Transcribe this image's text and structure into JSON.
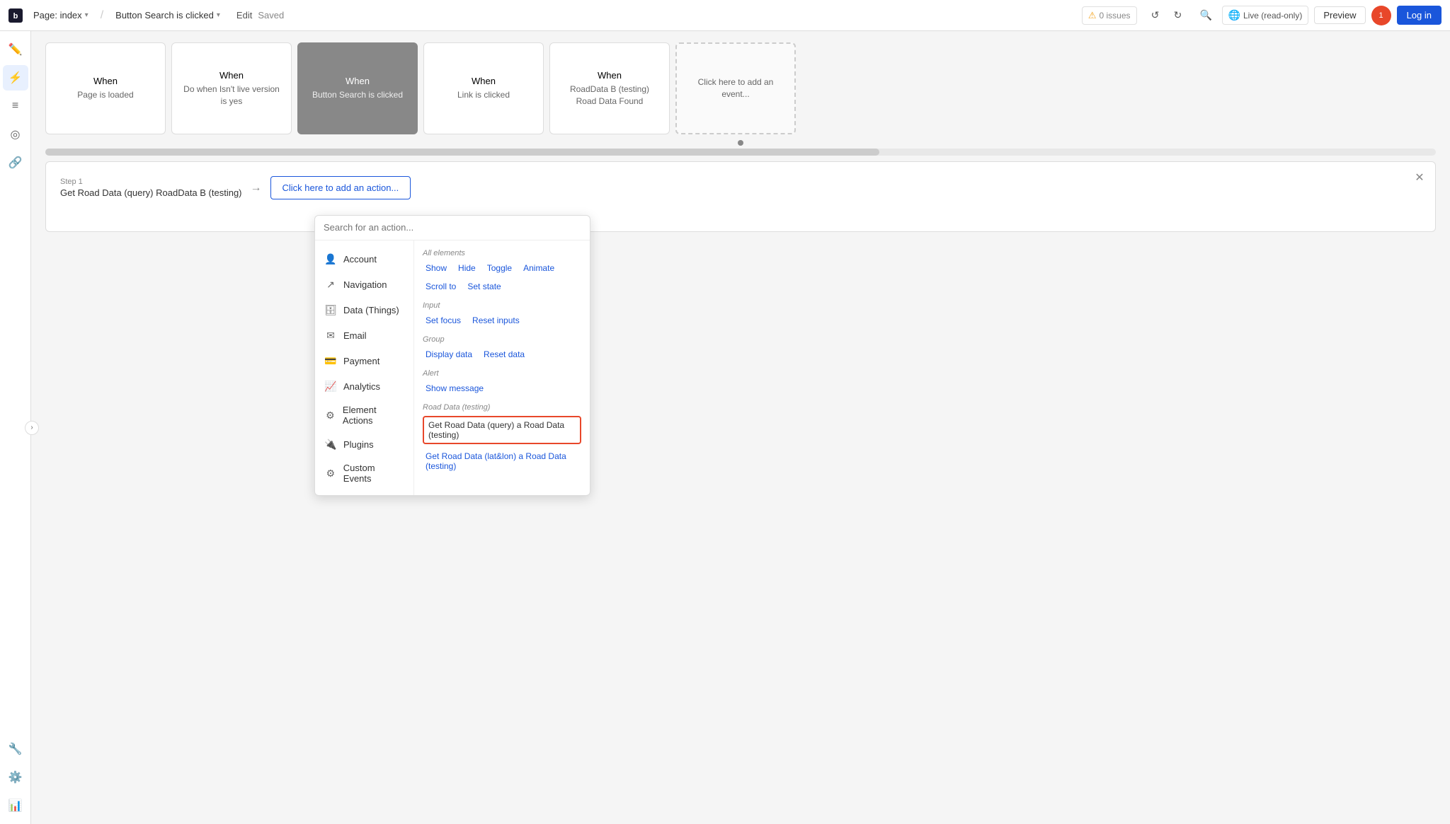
{
  "topbar": {
    "logo_label": "B",
    "page_label": "Page: index",
    "workflow_label": "Button Search is clicked",
    "edit_label": "Edit",
    "saved_label": "Saved",
    "issues_label": "0 issues",
    "live_label": "Live (read-only)",
    "preview_label": "Preview",
    "login_label": "Log in",
    "notif_count": "1"
  },
  "sidebar": {
    "items": [
      {
        "icon": "✏️",
        "label": "edit",
        "active": false
      },
      {
        "icon": "⚡",
        "label": "workflow",
        "active": true
      },
      {
        "icon": "☰",
        "label": "elements",
        "active": false
      },
      {
        "icon": "◎",
        "label": "styles",
        "active": false
      },
      {
        "icon": "🔗",
        "label": "plugins",
        "active": false
      },
      {
        "icon": "🔧",
        "label": "tools",
        "active": false
      },
      {
        "icon": "⚙️",
        "label": "settings",
        "active": false
      },
      {
        "icon": "📊",
        "label": "data",
        "active": false
      }
    ]
  },
  "events": [
    {
      "when": "When",
      "desc": "Page is loaded",
      "active": false
    },
    {
      "when": "When",
      "desc": "Do when Isn't live version is yes",
      "active": false
    },
    {
      "when": "When",
      "desc": "Button Search is clicked",
      "active": true
    },
    {
      "when": "When",
      "desc": "Link is clicked",
      "active": false
    },
    {
      "when": "When",
      "desc": "RoadData B (testing) Road Data Found",
      "active": false
    },
    {
      "when": "",
      "desc": "Click here to add an event...",
      "active": false,
      "add": true
    }
  ],
  "workflow": {
    "step_label": "Step 1",
    "step_content": "Get Road Data (query) RoadData B (testing)",
    "add_action_label": "Click here to add an action..."
  },
  "dropdown": {
    "search_placeholder": "Search for an action...",
    "left_items": [
      {
        "icon": "👤",
        "label": "Account"
      },
      {
        "icon": "↗️",
        "label": "Navigation"
      },
      {
        "icon": "🗄️",
        "label": "Data (Things)"
      },
      {
        "icon": "✉️",
        "label": "Email"
      },
      {
        "icon": "💳",
        "label": "Payment"
      },
      {
        "icon": "📈",
        "label": "Analytics"
      },
      {
        "icon": "⚙️",
        "label": "Element Actions"
      },
      {
        "icon": "🔌",
        "label": "Plugins"
      },
      {
        "icon": "⚙️",
        "label": "Custom Events"
      }
    ],
    "sections": [
      {
        "title": "All elements",
        "items": [
          {
            "label": "Show",
            "highlighted": false
          },
          {
            "label": "Hide",
            "highlighted": false
          },
          {
            "label": "Toggle",
            "highlighted": false
          },
          {
            "label": "Animate",
            "highlighted": false
          },
          {
            "label": "Scroll to",
            "highlighted": false
          },
          {
            "label": "Set state",
            "highlighted": false
          }
        ]
      },
      {
        "title": "Input",
        "items": [
          {
            "label": "Set focus",
            "highlighted": false
          },
          {
            "label": "Reset inputs",
            "highlighted": false
          }
        ]
      },
      {
        "title": "Group",
        "items": [
          {
            "label": "Display data",
            "highlighted": false
          },
          {
            "label": "Reset data",
            "highlighted": false
          }
        ]
      },
      {
        "title": "Alert",
        "items": [
          {
            "label": "Show message",
            "highlighted": false
          }
        ]
      },
      {
        "title": "Road Data (testing)",
        "items": [
          {
            "label": "Get Road Data (query) a Road Data (testing)",
            "highlighted": true
          },
          {
            "label": "Get Road Data (lat&lon) a Road Data (testing)",
            "highlighted": false
          }
        ]
      }
    ]
  }
}
